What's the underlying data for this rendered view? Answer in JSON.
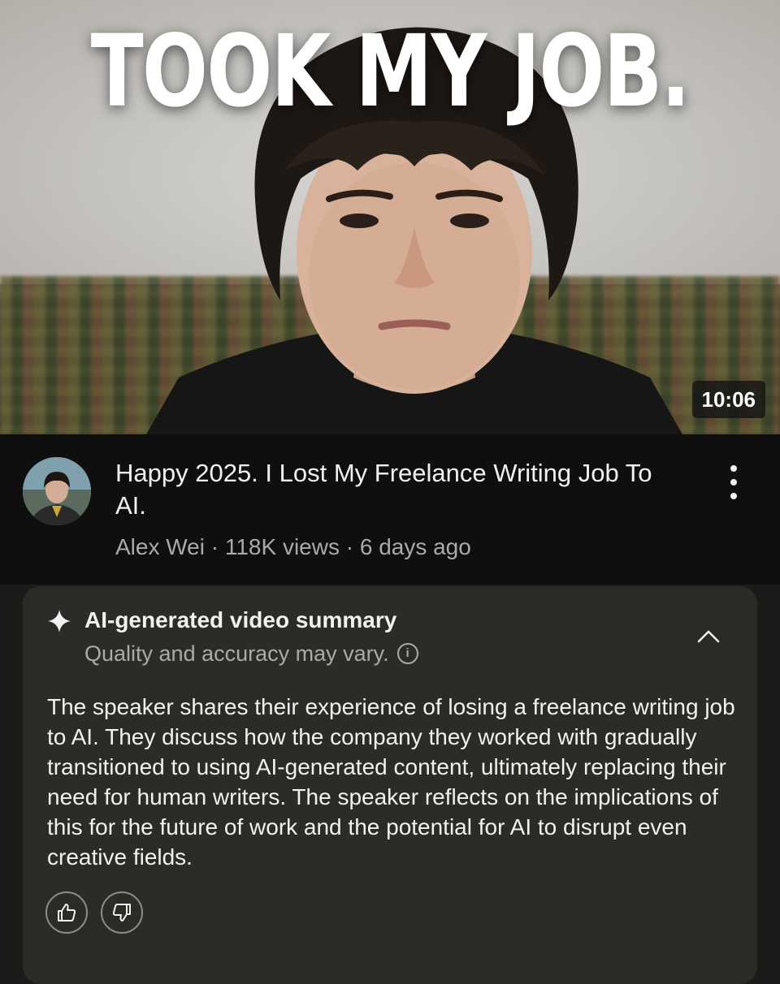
{
  "thumbnail": {
    "overlay_text": "TOOK MY JOB.",
    "duration": "10:06"
  },
  "video": {
    "title": "Happy 2025. I Lost My Freelance Writing Job To AI.",
    "subtitle": "Alex Wei · 118K views · 6 days ago",
    "channel_avatar": "avatar-icon",
    "more_icon": "more-vert-icon"
  },
  "summary": {
    "icon": "sparkle-icon",
    "title": "AI-generated video summary",
    "note": "Quality and accuracy may vary.",
    "info_icon": "info-icon",
    "info_glyph": "i",
    "collapse_icon": "chevron-up-icon",
    "body": "The speaker shares their experience of losing a freelance writing job to AI. They discuss how the company they worked with gradually transitioned to using AI-generated content, ultimately replacing their need for human writers. The speaker reflects on the implications of this for the future of work and the potential for AI to disrupt even creative fields.",
    "feedback": {
      "like_icon": "thumbs-up-icon",
      "dislike_icon": "thumbs-down-icon"
    }
  },
  "colors": {
    "page_bg": "#0f0f0f",
    "card_bg": "#2d2b28",
    "primary_text": "#f1f1f1",
    "secondary_text": "#aaaaaa"
  }
}
